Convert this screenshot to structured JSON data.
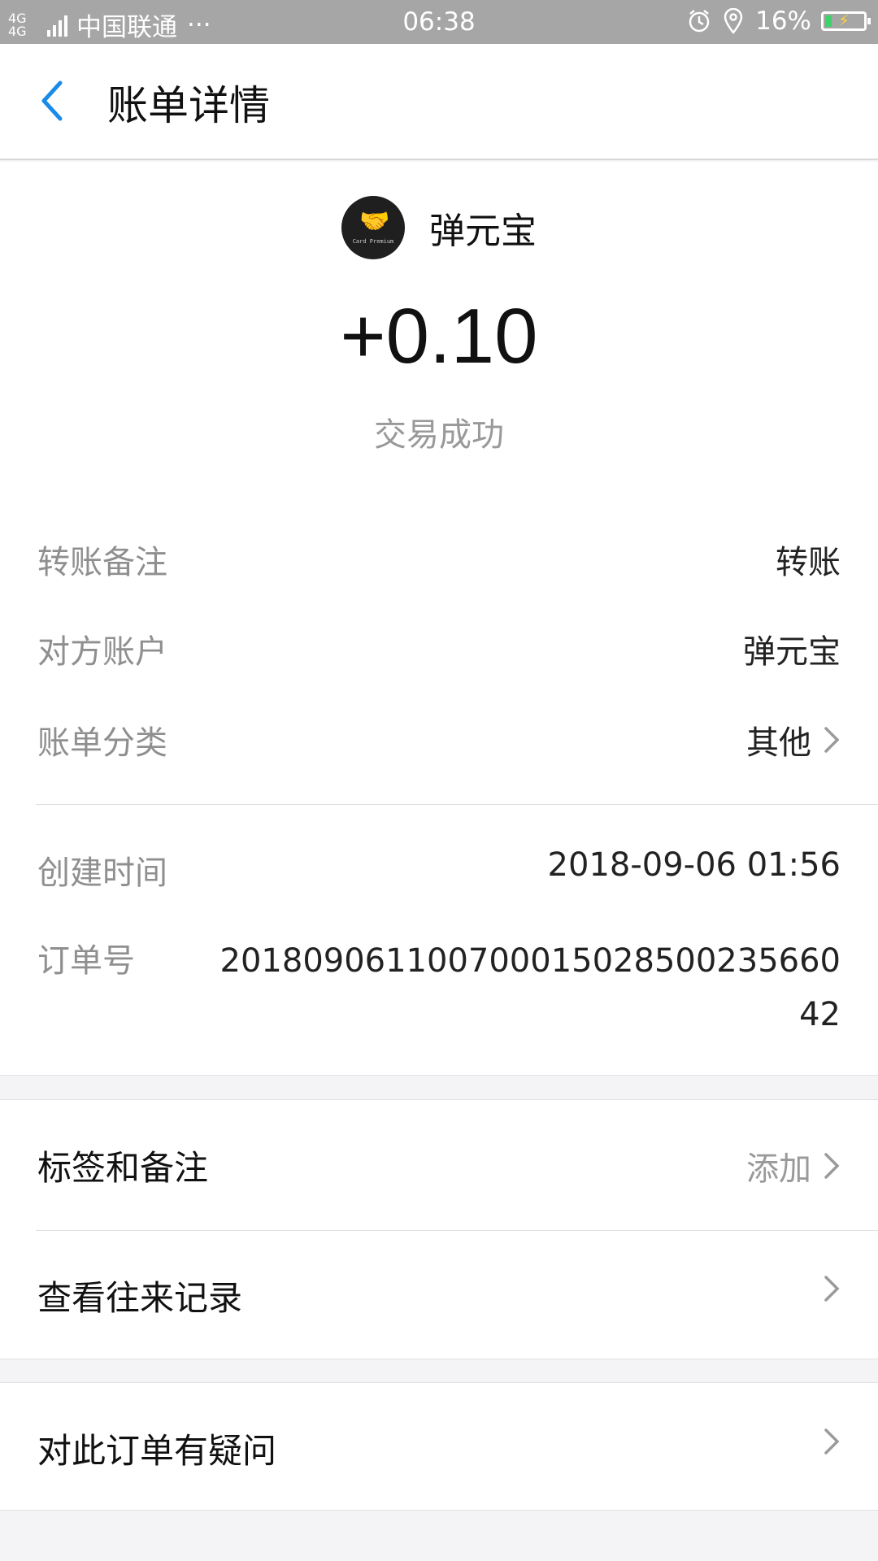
{
  "status_bar": {
    "network": "4G 4G",
    "carrier": "中国联通",
    "dots": "···",
    "time": "06:38",
    "battery": "16%",
    "alarm_icon": "alarm-icon",
    "location_icon": "location-icon"
  },
  "header": {
    "title": "账单详情",
    "back_icon": "back-arrow-icon"
  },
  "merchant": {
    "name": "弹元宝",
    "avatar_text": "Card Premium"
  },
  "transaction": {
    "amount": "+0.10",
    "status": "交易成功"
  },
  "details": [
    {
      "label": "转账备注",
      "value": "转账"
    },
    {
      "label": "对方账户",
      "value": "弹元宝"
    },
    {
      "label": "账单分类",
      "value": "其他"
    },
    {
      "label": "创建时间",
      "value": "2018-09-06 01:56"
    }
  ],
  "order": {
    "label": "订单号",
    "value": "20180906110070001502850023566042"
  },
  "actions": {
    "tags": {
      "label": "标签和备注",
      "action": "添加"
    },
    "history": {
      "label": "查看往来记录"
    },
    "question": {
      "label": "对此订单有疑问"
    }
  },
  "colors": {
    "accent": "#1a8be8",
    "status_bar": "#a6a6a6",
    "page_bg": "#f4f4f7"
  }
}
